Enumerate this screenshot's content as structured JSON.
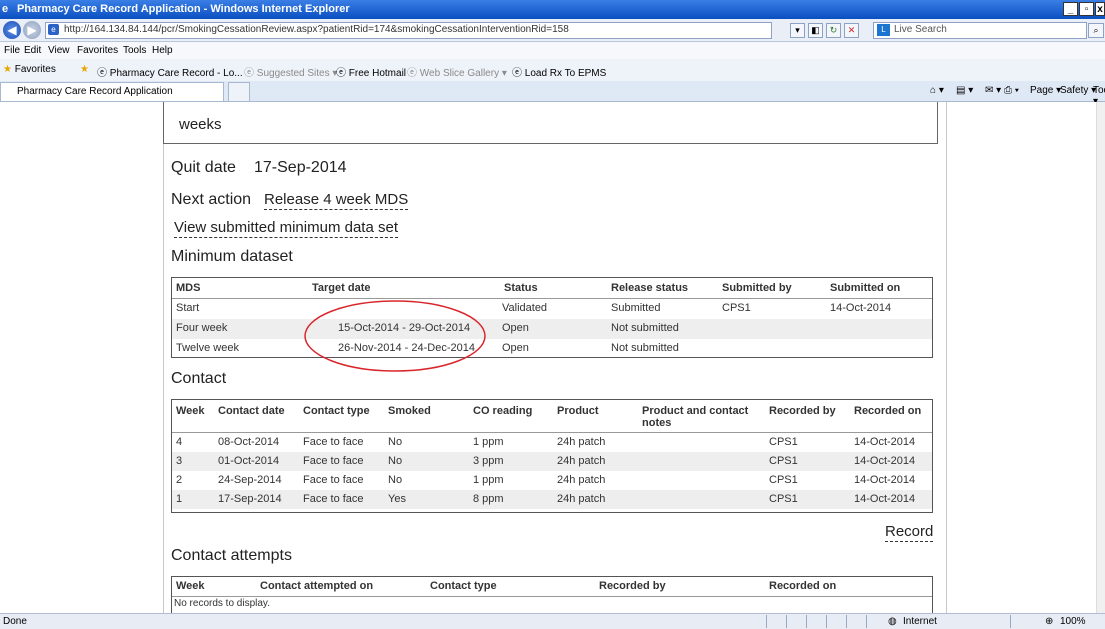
{
  "window": {
    "title": "Pharmacy Care Record Application - Windows Internet Explorer"
  },
  "browser": {
    "address": "http://164.134.84.144/pcr/SmokingCessationReview.aspx?patientRid=174&smokingCessationInterventionRid=158",
    "search_placeholder": "Live Search",
    "menu": [
      "File",
      "Edit",
      "View",
      "Favorites",
      "Tools",
      "Help"
    ],
    "favorites_label": "Favorites",
    "favorites": [
      {
        "label": "Pharmacy Care Record - Lo...",
        "dim": false
      },
      {
        "label": "Suggested Sites ▾",
        "dim": true
      },
      {
        "label": "Free Hotmail",
        "dim": false
      },
      {
        "label": "Web Slice Gallery ▾",
        "dim": true
      },
      {
        "label": "Load Rx To EPMS",
        "dim": false
      }
    ],
    "tab_label": "Pharmacy Care Record Application",
    "command_bar": [
      "Page ▾",
      "Safety ▾",
      "Tools ▾"
    ],
    "status_text": "Done",
    "zone": "Internet",
    "zoom": "100%"
  },
  "page": {
    "weeks_text": "weeks",
    "quit_date_label": "Quit date",
    "quit_date_value": "17-Sep-2014",
    "next_action_label": "Next action",
    "next_action_link": "Release 4 week MDS",
    "view_link": "View submitted minimum data set",
    "mds_heading": "Minimum dataset",
    "mds_headers": [
      "MDS",
      "Target date",
      "Status",
      "Release status",
      "Submitted by",
      "Submitted on"
    ],
    "mds_rows": [
      [
        "Start",
        "-",
        "Validated",
        "Submitted",
        "CPS1",
        "14-Oct-2014"
      ],
      [
        "Four week",
        "15-Oct-2014 - 29-Oct-2014",
        "Open",
        "Not submitted",
        "",
        ""
      ],
      [
        "Twelve week",
        "26-Nov-2014 - 24-Dec-2014",
        "Open",
        "Not submitted",
        "",
        ""
      ]
    ],
    "contact_heading": "Contact",
    "contact_headers": [
      "Week",
      "Contact date",
      "Contact type",
      "Smoked",
      "CO reading",
      "Product",
      "Product and contact notes",
      "Recorded by",
      "Recorded on"
    ],
    "contact_rows": [
      [
        "4",
        "08-Oct-2014",
        "Face to face",
        "No",
        "1 ppm",
        "24h patch",
        "",
        "CPS1",
        "14-Oct-2014"
      ],
      [
        "3",
        "01-Oct-2014",
        "Face to face",
        "No",
        "3 ppm",
        "24h patch",
        "",
        "CPS1",
        "14-Oct-2014"
      ],
      [
        "2",
        "24-Sep-2014",
        "Face to face",
        "No",
        "1 ppm",
        "24h patch",
        "",
        "CPS1",
        "14-Oct-2014"
      ],
      [
        "1",
        "17-Sep-2014",
        "Face to face",
        "Yes",
        "8 ppm",
        "24h patch",
        "",
        "CPS1",
        "14-Oct-2014"
      ]
    ],
    "record_link": "Record",
    "attempts_heading": "Contact attempts",
    "attempts_headers": [
      "Week",
      "Contact attempted on",
      "Contact type",
      "Recorded by",
      "Recorded on"
    ],
    "attempts_empty": "No records to display."
  },
  "annotation_color": "#d9262c"
}
